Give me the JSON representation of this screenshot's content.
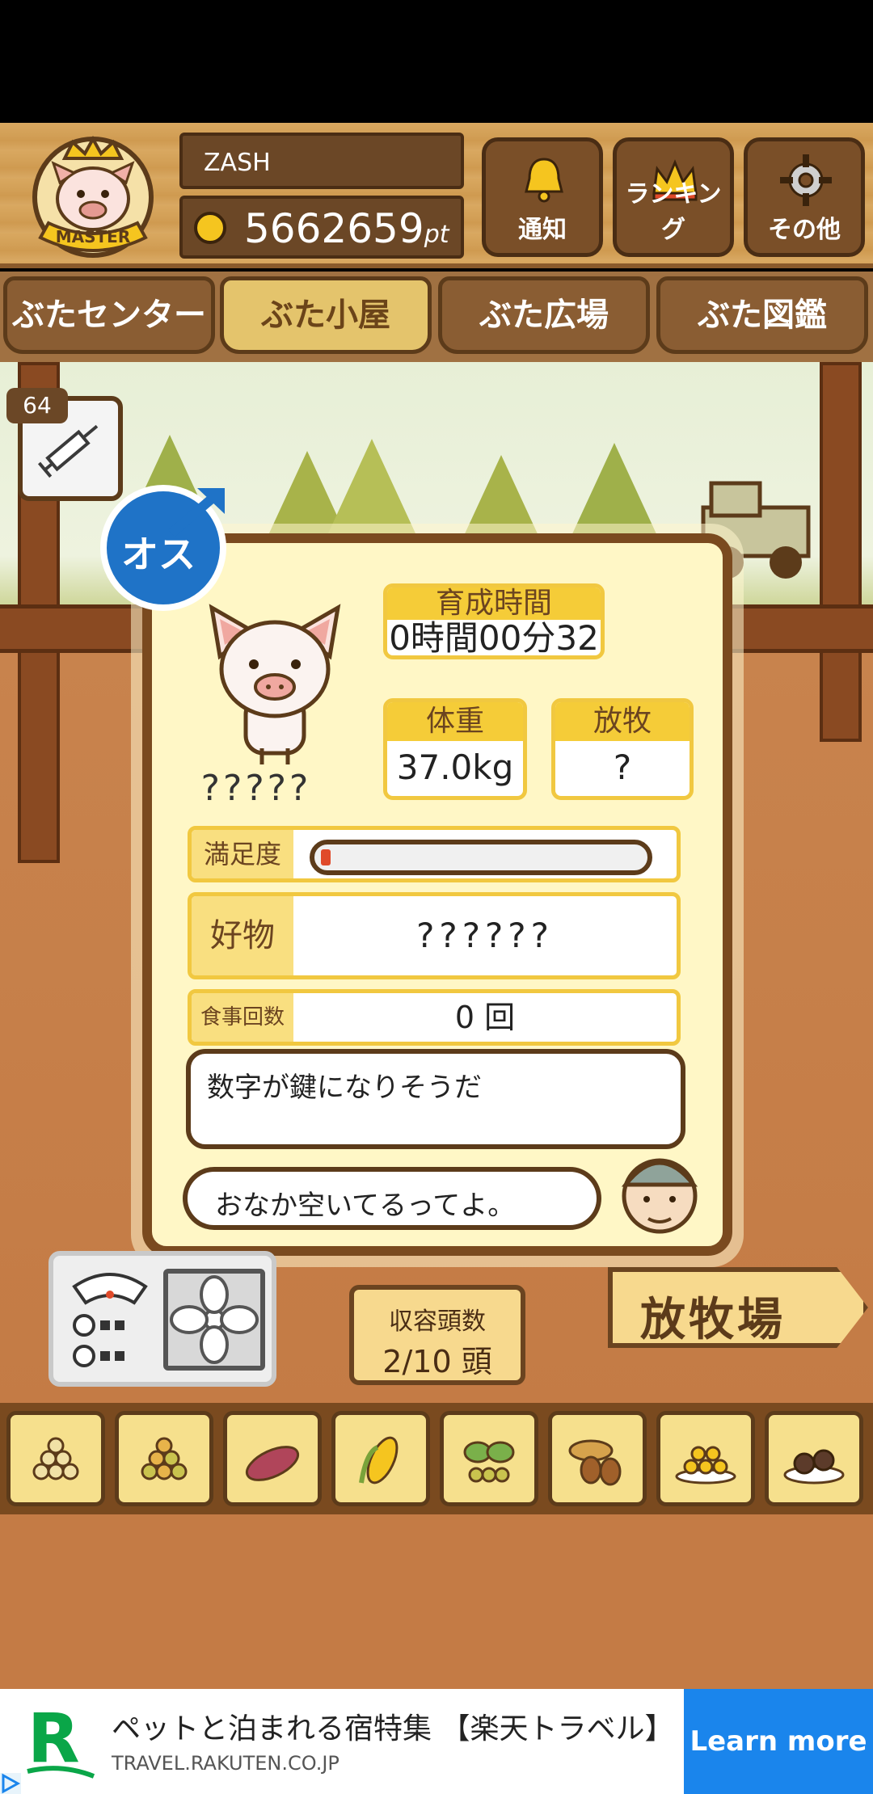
{
  "header": {
    "player_name": "ZASH",
    "points_value": "5662659",
    "points_unit": "pt",
    "badge_label": "MASTER",
    "buttons": [
      {
        "label": "通知",
        "icon": "bell-icon"
      },
      {
        "label": "ランキング",
        "icon": "crown-icon"
      },
      {
        "label": "その他",
        "icon": "gear-icon"
      }
    ]
  },
  "tabs": [
    {
      "label": "ぶたセンター",
      "active": false
    },
    {
      "label": "ぶた小屋",
      "active": true
    },
    {
      "label": "ぶた広場",
      "active": false
    },
    {
      "label": "ぶた図鑑",
      "active": false
    }
  ],
  "item_badge": {
    "count": "64",
    "icon": "syringe-icon"
  },
  "pig": {
    "gender_label": "オス",
    "name": "?????",
    "raising_time_label": "育成時間",
    "raising_time_value": "0時間00分32秒",
    "weight_label": "体重",
    "weight_value": "37.0kg",
    "grazing_label": "放牧",
    "grazing_value": "?",
    "satisfaction_label": "満足度",
    "satisfaction_level": 0.03,
    "favorite_label": "好物",
    "favorite_value": "??????",
    "meals_label": "食事回数",
    "meals_value": "0 回"
  },
  "dialogue": {
    "hint": "数字が鍵になりそうだ",
    "status": "おなか空いてるってよ。"
  },
  "capacity": {
    "label": "収容頭数",
    "value": "2/10 頭"
  },
  "pasture_sign": "放牧場",
  "feeds": [
    "grain-icon",
    "mixed-grain-icon",
    "sweet-potato-icon",
    "corn-icon",
    "herb-icon",
    "acorn-icon",
    "grain-plate-icon",
    "truffle-plate-icon"
  ],
  "ad": {
    "title": "ペットと泊まれる宿特集 【楽天トラベル】",
    "domain": "TRAVEL.RAKUTEN.CO.JP",
    "cta": "Learn more",
    "logo_letter": "R"
  },
  "colors": {
    "accent_yellow": "#f5cc38",
    "wood_dark": "#5c3b1a",
    "ad_blue": "#1a85ec",
    "male_blue": "#1f73c7"
  }
}
